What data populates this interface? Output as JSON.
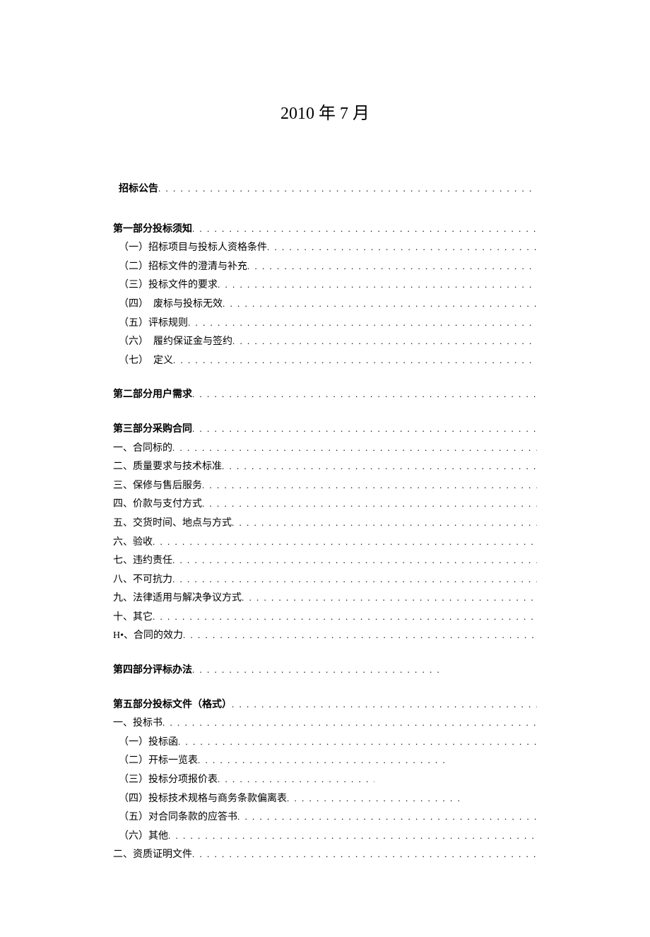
{
  "heading": "2010 年 7 月",
  "toc": {
    "section0": {
      "items": [
        {
          "label": "招标公告",
          "bold": true,
          "indent": 1
        }
      ]
    },
    "section1": {
      "items": [
        {
          "label": "第一部分投标须知",
          "bold": true,
          "indent": 0
        },
        {
          "label": "（一）招标项目与投标人资格条件",
          "bold": false,
          "indent": 1
        },
        {
          "label": "（二）招标文件的澄清与补充",
          "bold": false,
          "indent": 1
        },
        {
          "label": "（三）投标文件的要求",
          "bold": false,
          "indent": 1
        },
        {
          "label": "（四）　废标与投标无效",
          "bold": false,
          "indent": 1
        },
        {
          "label": "（五）评标规则",
          "bold": false,
          "indent": 1
        },
        {
          "label": "（六）　履约保证金与签约",
          "bold": false,
          "indent": 1
        },
        {
          "label": "（七）　定义",
          "bold": false,
          "indent": 1
        }
      ]
    },
    "section2": {
      "items": [
        {
          "label": "第二部分用户需求",
          "bold": true,
          "indent": 0
        }
      ]
    },
    "section3": {
      "items": [
        {
          "label": "第三部分采购合同",
          "bold": true,
          "indent": 0
        },
        {
          "label": "一、合同标的",
          "bold": false,
          "indent": 0
        },
        {
          "label": "二、质量要求与技术标准",
          "bold": false,
          "indent": 0
        },
        {
          "label": "三、保修与售后服务",
          "bold": false,
          "indent": 0
        },
        {
          "label": "四、价款与支付方式",
          "bold": false,
          "indent": 0
        },
        {
          "label": "五、交货时间、地点与方式",
          "bold": false,
          "indent": 0
        },
        {
          "label": "六、验收",
          "bold": false,
          "indent": 0
        },
        {
          "label": "七、违约责任",
          "bold": false,
          "indent": 0
        },
        {
          "label": "八、不可抗力",
          "bold": false,
          "indent": 0
        },
        {
          "label": "九、法律适用与解决争议方式",
          "bold": false,
          "indent": 0
        },
        {
          "label": "十、其它",
          "bold": false,
          "indent": 0
        },
        {
          "label": "H•、合同的效力",
          "bold": false,
          "indent": 0
        }
      ]
    },
    "section4": {
      "items": [
        {
          "label": "第四部分评标办法",
          "bold": true,
          "indent": 0
        }
      ]
    },
    "section5": {
      "items": [
        {
          "label": "第五部分投标文件（格式）",
          "bold": true,
          "indent": 0
        },
        {
          "label": "一、投标书",
          "bold": false,
          "indent": 0
        },
        {
          "label": "（一）投标函",
          "bold": false,
          "indent": 1
        },
        {
          "label": "（二）开标一览表",
          "bold": false,
          "indent": 1
        },
        {
          "label": "（三）投标分项报价表",
          "bold": false,
          "indent": 1
        },
        {
          "label": "（四）投标技术规格与商务条款偏离表",
          "bold": false,
          "indent": 1
        },
        {
          "label": "（五）对合同条款的应答书",
          "bold": false,
          "indent": 1
        },
        {
          "label": "（六）其他",
          "bold": false,
          "indent": 1
        },
        {
          "label": "二、资质证明文件",
          "bold": false,
          "indent": 0
        }
      ]
    }
  },
  "dotsLong": " . . . . . . . . . . . . . . . . . . . . . . . . . . . . . . . . . . . . . . . . . . . . . . . . . . . . . . . . . . . . . . . . . . . . . . . . . . . . . . . ."
}
